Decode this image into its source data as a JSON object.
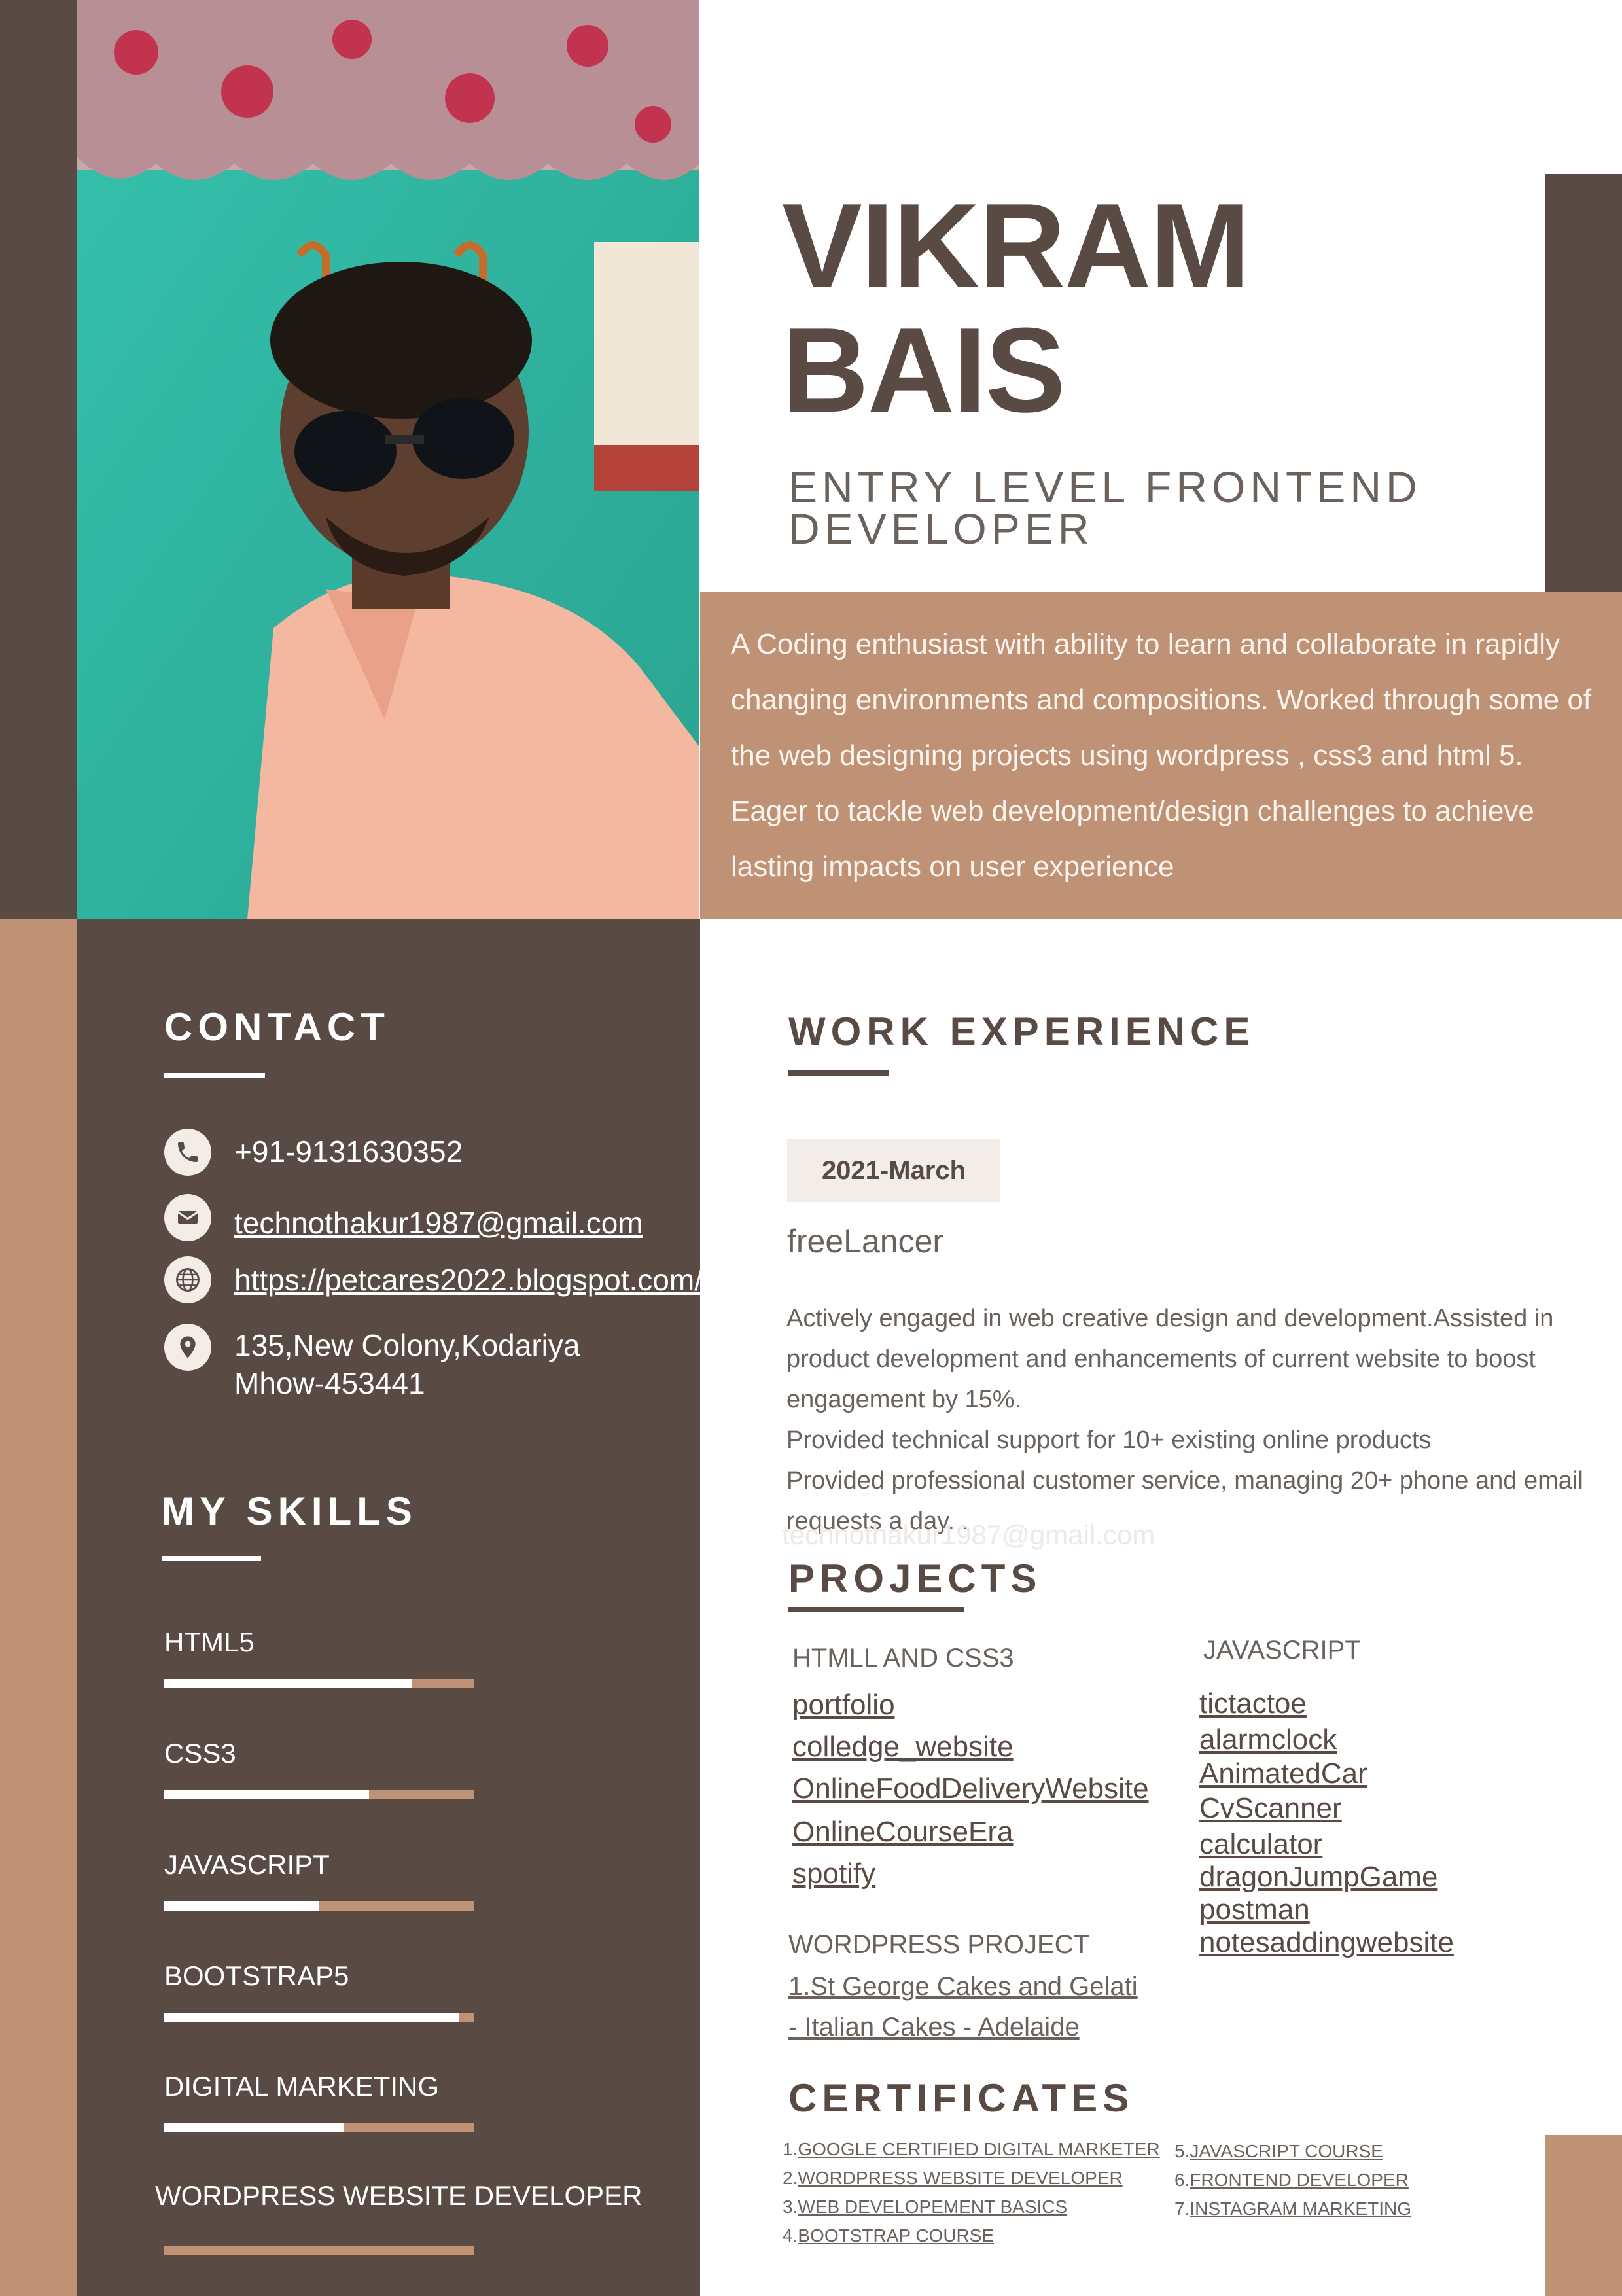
{
  "header": {
    "first_name": "VIKRAM",
    "last_name": "BAIS",
    "role_line1": "ENTRY LEVEL FRONTEND",
    "role_line2": "DEVELOPER",
    "summary": "A Coding enthusiast with ability to learn and collaborate in rapidly changing environments and compositions. Worked through some of the web designing projects using wordpress , css3 and html 5. Eager to tackle web development/design challenges to achieve lasting impacts on user experience"
  },
  "contact": {
    "title": "CONTACT",
    "phone": "+91-9131630352",
    "email": "technothakur1987@gmail.com",
    "website": "https://petcares2022.blogspot.com/",
    "address_line1": "135,New Colony,Kodariya",
    "address_line2": "Mhow-453441"
  },
  "skills": {
    "title": "MY SKILLS",
    "items": [
      {
        "label": "HTML5",
        "level": 0.8
      },
      {
        "label": "CSS3",
        "level": 0.66
      },
      {
        "label": "JAVASCRIPT",
        "level": 0.5
      },
      {
        "label": "BOOTSTRAP5",
        "level": 0.95
      },
      {
        "label": "DIGITAL MARKETING",
        "level": 0.58
      },
      {
        "label": "WORDPRESS WEBSITE DEVELOPER",
        "level": 0.0
      }
    ]
  },
  "work": {
    "title": "WORK EXPERIENCE",
    "date": "2021-March",
    "job_title": "freeLancer",
    "desc_lines": [
      "Actively engaged in web creative design and development.Assisted in",
      "product development and enhancements of current website to boost",
      "engagement by 15%.",
      "Provided technical support for 10+ existing online products",
      "Provided professional customer service, managing 20+ phone and email",
      "requests a day. ."
    ],
    "ghost_text": "technothakur1987@gmail.com"
  },
  "projects": {
    "title": "PROJECTS",
    "html_css_title": "HTMLL AND CSS3",
    "html_css_items": [
      "portfolio",
      "colledge_website",
      "OnlineFoodDeliveryWebsite",
      "OnlineCourseEra",
      "spotify"
    ],
    "js_title": "JAVASCRIPT",
    "js_items": [
      "tictactoe",
      "alarmclock",
      "AnimatedCar",
      "CvScanner",
      "calculator",
      "dragonJumpGame",
      "postman",
      "notesaddingwebsite"
    ],
    "wp_title": "WORDPRESS PROJECT",
    "wp_line1": "1.St George Cakes and Gelati",
    "wp_line2": "- Italian Cakes - Adelaide"
  },
  "certificates": {
    "title": "CERTIFICATES",
    "left": [
      {
        "num": "1.",
        "label": "GOOGLE CERTIFIED DIGITAL MARKETER"
      },
      {
        "num": "2.",
        "label": "WORDPRESS WEBSITE DEVELOPER"
      },
      {
        "num": "3.",
        "label": "WEB DEVELOPEMENT BASICS"
      },
      {
        "num": "4.",
        "label": "BOOTSTRAP COURSE"
      }
    ],
    "right": [
      {
        "num": "5.",
        "label": "JAVASCRIPT COURSE"
      },
      {
        "num": "6.",
        "label": "FRONTEND DEVELOPER"
      },
      {
        "num": "7.",
        "label": "INSTAGRAM MARKETING"
      }
    ]
  },
  "colors": {
    "dark_brown": "#594b44",
    "tan": "#bf9276",
    "teal_wall": "#3fb8a4",
    "shirt_peach": "#f4b7a0"
  }
}
